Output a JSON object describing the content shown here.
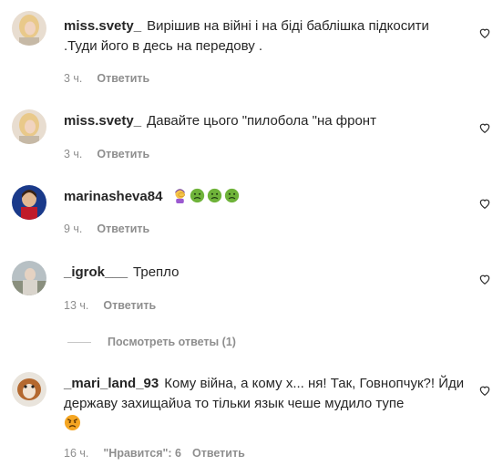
{
  "comments": [
    {
      "username": "miss.svety_",
      "text": "Вирішив на війні і на біді баблішка підкосити .Туди його в десь на передову .",
      "time": "3 ч.",
      "reply_label": "Ответить"
    },
    {
      "username": "miss.svety_",
      "text": "Давайте цього \"пилобола \"на фронт",
      "time": "3 ч.",
      "reply_label": "Ответить"
    },
    {
      "username": "marinasheva84",
      "text": "",
      "emojis": [
        "woman-facepalming-emoji",
        "nauseated-face-emoji",
        "nauseated-face-emoji",
        "nauseated-face-emoji"
      ],
      "time": "9 ч.",
      "reply_label": "Ответить"
    },
    {
      "username": "_igrok___",
      "text": "Трепло",
      "time": "13 ч.",
      "reply_label": "Ответить",
      "view_replies_label": "Посмотреть ответы (1)"
    },
    {
      "username": "_mari_land_93",
      "text": "Кому війна, а кому х... ня! Так, Говнопчук?! Йди державу захищайᴜа то тільки язык чеше мудило тупе",
      "emojis": [
        "angry-face-emoji"
      ],
      "time": "16 ч.",
      "likes_label": "\"Нравится\": 6",
      "reply_label": "Ответить"
    }
  ],
  "colors": {
    "text": "#262626",
    "meta": "#8e8e8e",
    "background": "#ffffff"
  }
}
